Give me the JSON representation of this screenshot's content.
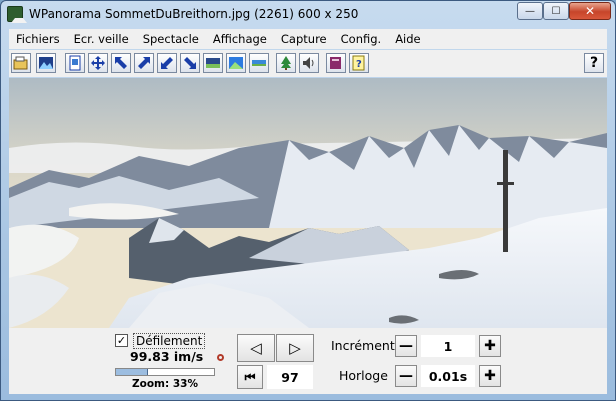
{
  "window": {
    "title": "WPanorama  SommetDuBreithorn.jpg  (2261) 600 x 250",
    "min_glyph": "—",
    "max_glyph": "☐",
    "close_glyph": "✕"
  },
  "menu": [
    "Fichiers",
    "Ecr. veille",
    "Spectacle",
    "Affichage",
    "Capture",
    "Config.",
    "Aide"
  ],
  "toolbar": {
    "help_label": "?",
    "icons": [
      "open-icon",
      "image-icon",
      "page-icon",
      "move-icon",
      "left-up-icon",
      "expand-icon",
      "shrink-icon",
      "right-down-icon",
      "image-wide-icon",
      "image-blue-icon",
      "image-strip-icon",
      "tree-icon",
      "sound-icon",
      "book-icon",
      "help-page-icon"
    ]
  },
  "controls": {
    "scroll_checked": "✓",
    "scroll_label": "Défilement",
    "speed": "99.83 im/s",
    "zoom": {
      "label": "Zoom: 33%",
      "level_percent": 33
    },
    "prev_glyph": "◁",
    "next_glyph": "▷",
    "first_glyph": "⏮",
    "image_index": "97",
    "increment": {
      "label": "Incrément",
      "value": "1",
      "minus": "—",
      "plus": "✚"
    },
    "clock": {
      "label": "Horloge",
      "value": "0.01s",
      "minus": "—",
      "plus": "✚"
    }
  },
  "colors": {
    "accent": "#1a3ea8",
    "sky": "#c9d3d9",
    "snow": "#f1f4f8",
    "rock": "#4a525e"
  }
}
